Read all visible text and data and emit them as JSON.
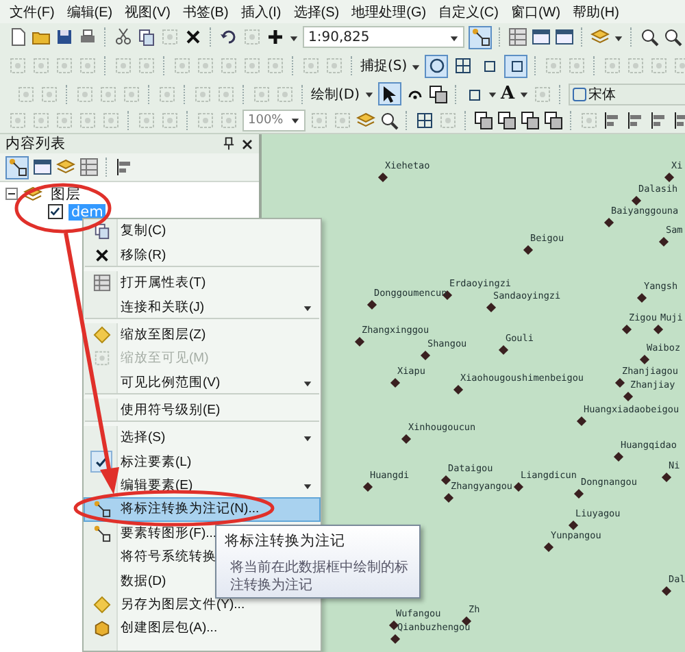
{
  "menu_bar": [
    "文件(F)",
    "编辑(E)",
    "视图(V)",
    "书签(B)",
    "插入(I)",
    "选择(S)",
    "地理处理(G)",
    "自定义(C)",
    "窗口(W)",
    "帮助(H)"
  ],
  "toolbars": [
    {
      "kind": "standard",
      "scale": "1:90,825"
    },
    {
      "kind": "editor",
      "snapping_menu": "捕捉(S)"
    },
    {
      "kind": "draw",
      "draw_menu": "绘制(D)",
      "text_tool": "A",
      "font": "宋体"
    },
    {
      "kind": "layout",
      "zoom_percent": "100%"
    }
  ],
  "toc": {
    "title": "内容列表",
    "tree": [
      {
        "label": "图层",
        "expanded": true,
        "children": [
          {
            "label": "dem",
            "checked": true,
            "selected": true
          }
        ]
      }
    ]
  },
  "context_menu": [
    {
      "label": "复制(C)",
      "selected": false,
      "disabled": false,
      "checked": false,
      "submenu": false
    },
    {
      "label": "移除(R)",
      "selected": false,
      "disabled": false,
      "checked": false,
      "submenu": false,
      "separator_after": true
    },
    {
      "label": "打开属性表(T)",
      "selected": false,
      "disabled": false,
      "checked": false,
      "submenu": false,
      "separator_after": false
    },
    {
      "label": "连接和关联(J)",
      "selected": false,
      "disabled": false,
      "checked": false,
      "submenu": true,
      "separator_after": true
    },
    {
      "label": "缩放至图层(Z)",
      "selected": false,
      "disabled": false,
      "checked": false,
      "submenu": false
    },
    {
      "label": "缩放至可见(M)",
      "selected": false,
      "disabled": true,
      "checked": false,
      "submenu": false
    },
    {
      "label": "可见比例范围(V)",
      "selected": false,
      "disabled": false,
      "checked": false,
      "submenu": true,
      "separator_after": true
    },
    {
      "label": "使用符号级别(E)",
      "selected": false,
      "disabled": false,
      "checked": false,
      "submenu": false,
      "separator_after": true
    },
    {
      "label": "选择(S)",
      "selected": false,
      "disabled": false,
      "checked": false,
      "submenu": true
    },
    {
      "label": "标注要素(L)",
      "selected": false,
      "disabled": false,
      "checked": true,
      "submenu": false
    },
    {
      "label": "编辑要素(E)",
      "selected": false,
      "disabled": false,
      "checked": false,
      "submenu": true
    },
    {
      "label": "将标注转换为注记(N)...",
      "selected": true,
      "disabled": false,
      "checked": false,
      "submenu": false
    },
    {
      "label": "要素转图形(F)...",
      "selected": false,
      "disabled": false,
      "checked": false
    },
    {
      "label": "将符号系统转换",
      "selected": false,
      "disabled": false,
      "checked": false
    },
    {
      "label": "数据(D)",
      "selected": false,
      "disabled": false,
      "checked": false
    },
    {
      "label": "另存为图层文件(Y)...",
      "selected": false,
      "disabled": false,
      "checked": false,
      "submenu": false
    },
    {
      "label": "创建图层包(A)...",
      "selected": false,
      "disabled": false,
      "checked": false,
      "submenu": false
    }
  ],
  "tooltip": {
    "title": "将标注转换为注记",
    "description": "将当前在此数据框中绘制的标注转换为注记"
  },
  "map_labels": [
    "Xiehetao",
    "Xi",
    "Dalasih",
    "Baiyanggouna",
    "Beigou",
    "Sam",
    "Erdaoyingzi",
    "Donggoumencun",
    "Sandaoyingzi",
    "Yangsh",
    "Zhangxinggou",
    "Shangou",
    "Gouli",
    "Zigou",
    "Muji",
    "Xiapu",
    "Xiaohougoushimenbeigou",
    "Waiboz",
    "Zhanjiagou",
    "Zhanjiay",
    "Huangxiadaobeigou",
    "Xinhougoucun",
    "Huangqidao",
    "Ni",
    "Huangdi",
    "Dataigou",
    "Zhangyangou",
    "Liangdicun",
    "Dongnangou",
    "Liuyagou",
    "Yunpangou",
    "Dal",
    "Zh",
    "Wufangou",
    "Qianbuzhengou"
  ]
}
